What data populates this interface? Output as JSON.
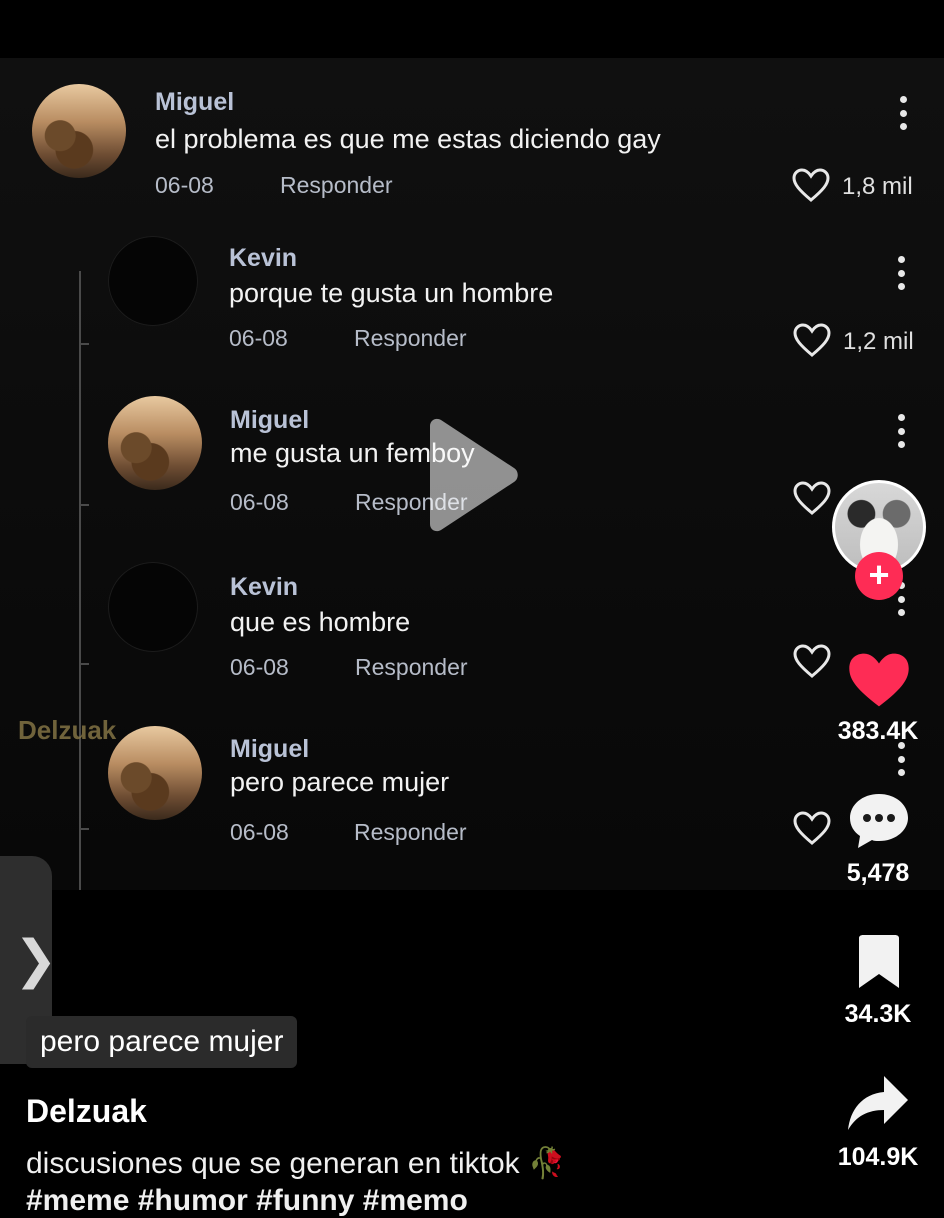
{
  "comments": [
    {
      "name": "Miguel",
      "text": "el problema es que me estas diciendo gay",
      "date": "06-08",
      "reply": "Responder",
      "likes": "1,8 mil",
      "avatar": "photo"
    },
    {
      "name": "Kevin",
      "text": "porque te gusta un hombre",
      "date": "06-08",
      "reply": "Responder",
      "likes": "1,2 mil",
      "avatar": "empty"
    },
    {
      "name": "Miguel",
      "text": "me gusta un femboy",
      "date": "06-08",
      "reply": "Responder",
      "likes": "",
      "avatar": "photo"
    },
    {
      "name": "Kevin",
      "text": "que es hombre",
      "date": "06-08",
      "reply": "Responder",
      "likes": "",
      "avatar": "empty"
    },
    {
      "name": "Miguel",
      "text": "pero parece mujer",
      "date": "06-08",
      "reply": "Responder",
      "likes": "",
      "avatar": "photo"
    }
  ],
  "watermark": "Delzuak",
  "actions": {
    "likes": "383.4K",
    "comments": "5,478",
    "saves": "34.3K",
    "shares": "104.9K"
  },
  "caption_chip": "pero parece mujer",
  "author": "Delzuak",
  "description": "discusiones que se generan en tiktok 🥀",
  "hashtags": "#meme #humor #funny #memo",
  "side_tab_glyph": "❯",
  "colors": {
    "accent": "#fe2c55",
    "like": "#fe2c55"
  }
}
